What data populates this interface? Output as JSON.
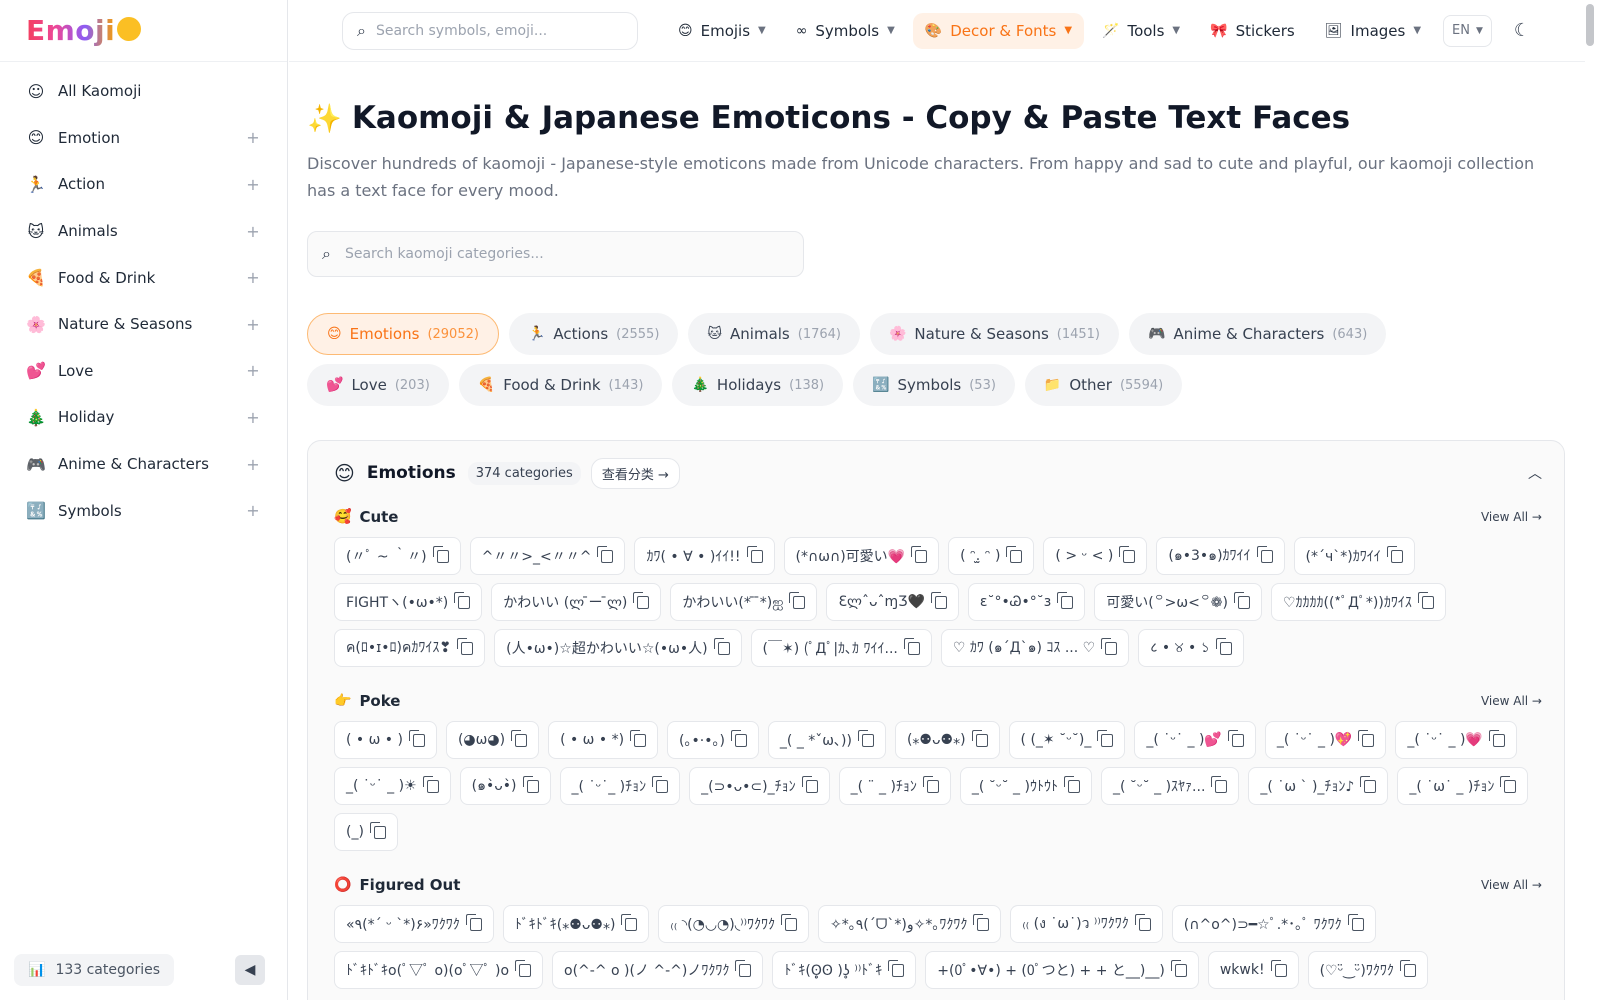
{
  "logo": {
    "text": "Emoji"
  },
  "sidebar": {
    "items": [
      {
        "label": "All Kaomoji",
        "icon": "smile-outline-icon",
        "glyph": "☺",
        "expandable": false
      },
      {
        "label": "Emotion",
        "icon": "smiley-icon",
        "glyph": "😊",
        "expandable": true
      },
      {
        "label": "Action",
        "icon": "running-icon",
        "glyph": "🏃",
        "expandable": true
      },
      {
        "label": "Animals",
        "icon": "cat-icon",
        "glyph": "🐱",
        "expandable": true
      },
      {
        "label": "Food & Drink",
        "icon": "pizza-icon",
        "glyph": "🍕",
        "expandable": true
      },
      {
        "label": "Nature & Seasons",
        "icon": "flower-icon",
        "glyph": "🌸",
        "expandable": true
      },
      {
        "label": "Love",
        "icon": "heart-icon",
        "glyph": "💕",
        "expandable": true
      },
      {
        "label": "Holiday",
        "icon": "tree-icon",
        "glyph": "🎄",
        "expandable": true
      },
      {
        "label": "Anime & Characters",
        "icon": "gamepad-icon",
        "glyph": "🎮",
        "expandable": true
      },
      {
        "label": "Symbols",
        "icon": "symbols-icon",
        "glyph": "🔣",
        "expandable": true
      }
    ],
    "footer_count": "133 categories"
  },
  "topbar": {
    "search_placeholder": "Search symbols, emoji...",
    "nav": [
      {
        "label": "Emojis",
        "icon": "smiley-icon",
        "glyph": "😊",
        "active": false,
        "dropdown": true
      },
      {
        "label": "Symbols",
        "icon": "infinity-icon",
        "glyph": "∞",
        "active": false,
        "dropdown": true
      },
      {
        "label": "Decor & Fonts",
        "icon": "palette-icon",
        "glyph": "🎨",
        "active": true,
        "dropdown": true
      },
      {
        "label": "Tools",
        "icon": "magic-wand-icon",
        "glyph": "🪄",
        "active": false,
        "dropdown": true
      },
      {
        "label": "Stickers",
        "icon": "ribbon-icon",
        "glyph": "🎀",
        "active": false,
        "dropdown": false
      },
      {
        "label": "Images",
        "icon": "image-icon",
        "glyph": "🖼",
        "active": false,
        "dropdown": true
      }
    ],
    "language": "EN"
  },
  "main": {
    "title": "Kaomoji & Japanese Emoticons - Copy & Paste Text Faces",
    "description": "Discover hundreds of kaomoji - Japanese-style emoticons made from Unicode characters. From happy and sad to cute and playful, our kaomoji collection has a text face for every mood.",
    "search_placeholder": "Search kaomoji categories...",
    "chips": [
      {
        "label": "Emotions",
        "count": "(29052)",
        "glyph": "😊",
        "active": true
      },
      {
        "label": "Actions",
        "count": "(2555)",
        "glyph": "🏃",
        "active": false
      },
      {
        "label": "Animals",
        "count": "(1764)",
        "glyph": "🐱",
        "active": false
      },
      {
        "label": "Nature & Seasons",
        "count": "(1451)",
        "glyph": "🌸",
        "active": false
      },
      {
        "label": "Anime & Characters",
        "count": "(643)",
        "glyph": "🎮",
        "active": false
      },
      {
        "label": "Love",
        "count": "(203)",
        "glyph": "💕",
        "active": false
      },
      {
        "label": "Food & Drink",
        "count": "(143)",
        "glyph": "🍕",
        "active": false
      },
      {
        "label": "Holidays",
        "count": "(138)",
        "glyph": "🎄",
        "active": false
      },
      {
        "label": "Symbols",
        "count": "(53)",
        "glyph": "🔣",
        "active": false
      },
      {
        "label": "Other",
        "count": "(5594)",
        "glyph": "📁",
        "active": false
      }
    ],
    "panel": {
      "title": "Emotions",
      "badge": "374 categories",
      "view_button": "查看分类 →",
      "sections": [
        {
          "name": "Cute",
          "glyph": "🥰",
          "view_all": "View All →",
          "items": [
            "(〃ﾟ ~ ｀〃)",
            "^〃〃>_<〃〃^",
            "ｶﾜ( • ∀ • )ｲｲ!!",
            "(*∩ω∩)可愛い💗",
            "( ᵔ.̫ ᵔ )",
            "( > ᵕ < )",
            "(๑•3•๑)ｶﾜｲｲ",
            "(*´ч`*)ｶﾜｲｲ",
            "FIGHTヽ(•ω•*)",
            "かわいい (ლ ̄ー ̄ლ)",
            "かわいい(* ̄ ̄*)ஐ",
            "ƐლˆᴗˆɱƷ🖤",
            "ɛ˘°•Ꮚ•°˘з",
            "可愛い(꒪>ω<꒪❁)",
            "♡ｶｶｶｶ((*ﾟДﾟ*))ｶﾜｲｽ",
            "ค(ﾛ•ɪ•ﾛ)คｶﾜｲｽ❣",
            "(人•ω•)☆超かわいい☆(•ω•人)",
            "(￣✶) (ﾟДﾟ|ｶ､ｶ ﾜｲｲ...",
            "♡ ｶﾜ (๑´Д`๑) ｺｽ ... ♡",
            "८ • ୪ • ১"
          ]
        },
        {
          "name": "Poke",
          "glyph": "👉",
          "view_all": "View All →",
          "items": [
            "( • ω • )",
            "(◕ω◕)",
            "( • ω • *)",
            "(｡•·•｡)",
            "_( _ *ˇω､))",
            "(⁎⚉ᴗ⚉⁎)",
            "( (_✶ ˘ᵕ˘)_",
            "_( ˙ᵕ˙ _ )💕",
            "_( ˙ᵕ˙ _ )💖",
            "_( ˙ᵕ˙ _ )💗",
            "_( ˙ᵕ˙ _ )☀",
            "(๑•̀ᴗ•̀)",
            "_( ˙ᵕ˙_ )ﾁｮﾝ",
            "_(⊃•ᴗ•⊂)_ﾁｮﾝ",
            "_( ¨ _ )ﾁｮﾝ",
            "_( ˘ᵕ˘ _ )ｳﾄｳﾄ",
            "_( ˘ᵕ˘ _ )ｽﾔｧ...",
            "_( ˙ω ` )_ﾁｮﾝ♪",
            "_( ˙ω˙ _ )ﾁｮﾝ",
            "(_)"
          ]
        },
        {
          "name": "Figured Out",
          "glyph": "⭕",
          "view_all": "View All →",
          "items": [
            "«٩(*´ ᵕ `*)۶»ﾜｸﾜｸ",
            "ﾄﾞｷﾄﾞｷ(⁎⚉ᴗ⚉⁎)",
            "₍₍ ◝(◔◡◔)◟⁾⁾ﾜｸﾜｸ",
            "✧*｡٩(ˊᗜˋ*)و✧*｡ﾜｸﾜｸ",
            "₍₍ (ง ˙ω˙)ว ⁾⁾ﾜｸﾜｸ",
            "(∩^o^)⊃━☆ﾟ.*･｡ﾟ ﾜｸﾜｸ",
            "ﾄﾞｷﾄﾞｷo(ﾟ▽ﾟ o)(oﾟ▽ﾟ )o",
            "o(^-^ o )(ノ ^-^)ノﾜｸﾜｸ",
            "ﾄﾞｷ(ʘ̥̥ʘ )ʖ̥ ⁾⁾ﾄﾞｷ",
            "+(0ﾟ•∀•) + (0ﾟつと) + + と__)__)",
            "wkwk!",
            "(♡ᵕ̈‿ᵕ̈)ﾜｸﾜｸ"
          ]
        }
      ]
    }
  },
  "colors": {
    "accent": "#f97316",
    "accent_bg": "#fff1e6"
  }
}
